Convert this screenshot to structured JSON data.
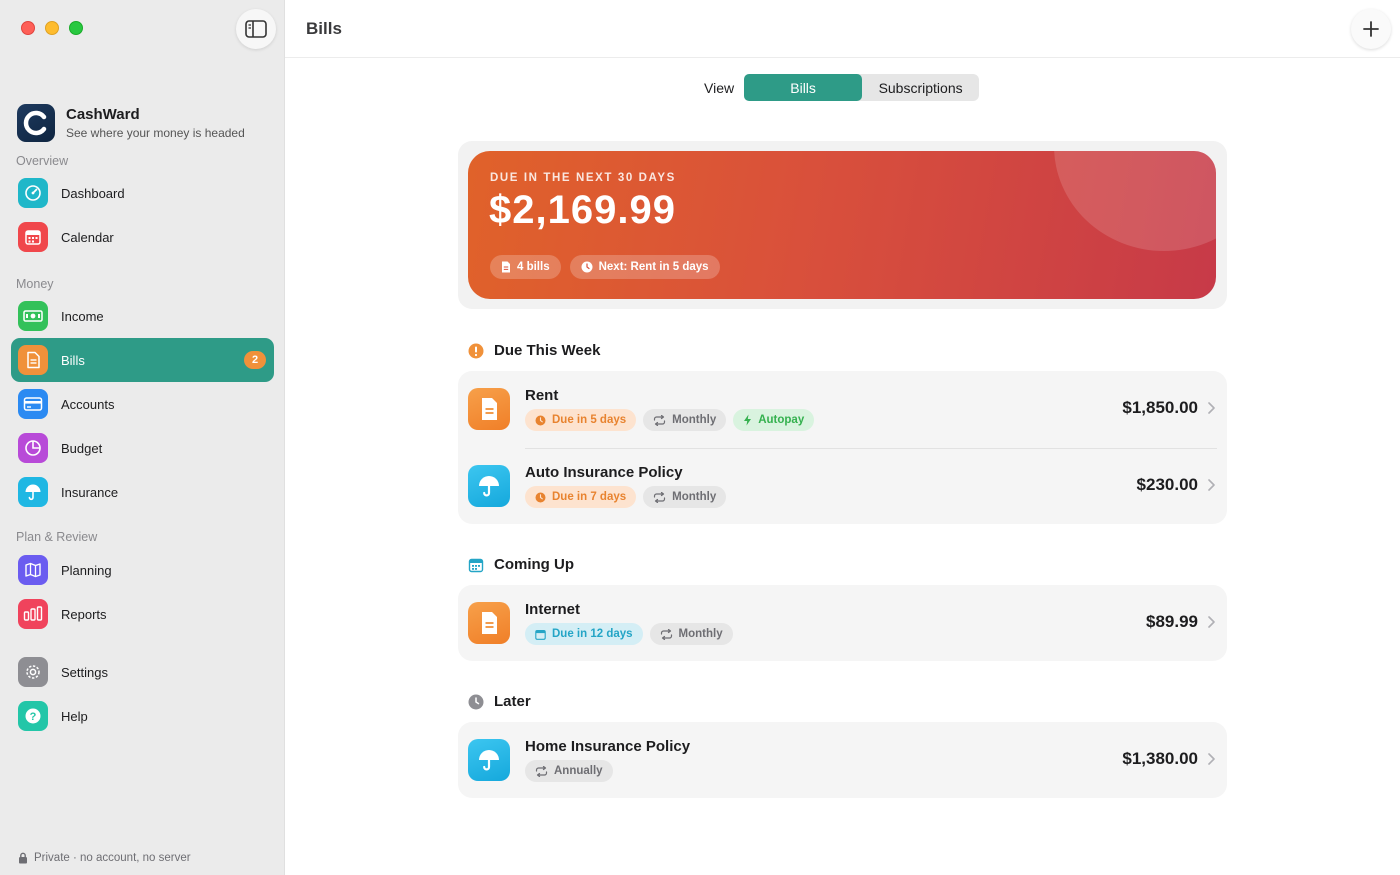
{
  "app": {
    "name": "CashWard",
    "tagline": "See where your money is headed",
    "footer_note": "Private · no account, no server"
  },
  "sidebar": {
    "sections": [
      {
        "label": "Overview"
      },
      {
        "label": "Money"
      },
      {
        "label": "Plan & Review"
      }
    ],
    "items": [
      {
        "label": "Dashboard",
        "icon": "gauge-icon",
        "color": "#1fb7c9"
      },
      {
        "label": "Calendar",
        "icon": "calendar-icon",
        "color": "#f0474b"
      },
      {
        "label": "Income",
        "icon": "banknote-icon",
        "color": "#33c15a"
      },
      {
        "label": "Bills",
        "icon": "document-icon",
        "color": "#f0913a",
        "badge": "2",
        "active": true
      },
      {
        "label": "Accounts",
        "icon": "card-icon",
        "color": "#2b8af2"
      },
      {
        "label": "Budget",
        "icon": "pie-icon",
        "color": "#b84ad8"
      },
      {
        "label": "Insurance",
        "icon": "umbrella-icon",
        "color": "#1fb7e3"
      },
      {
        "label": "Planning",
        "icon": "map-icon",
        "color": "#6b5cf0"
      },
      {
        "label": "Reports",
        "icon": "bar-chart-icon",
        "color": "#f0435c"
      },
      {
        "label": "Settings",
        "icon": "gear-icon",
        "color": "#8e8e93"
      },
      {
        "label": "Help",
        "icon": "question-icon",
        "color": "#23c6a8"
      }
    ]
  },
  "header": {
    "title": "Bills"
  },
  "view_switch": {
    "label": "View",
    "options": [
      "Bills",
      "Subscriptions"
    ],
    "selected": "Bills"
  },
  "summary": {
    "label": "DUE IN THE NEXT 30 DAYS",
    "amount": "$2,169.99",
    "bills_chip": "4 bills",
    "next_chip": "Next: Rent in 5 days"
  },
  "groups": [
    {
      "title": "Due This Week",
      "icon": "exclamation-icon",
      "bills": [
        {
          "name": "Rent",
          "icon": "document-icon",
          "amount": "$1,850.00",
          "chips": [
            {
              "text": "Due in 5 days",
              "style": "orange",
              "icon": "clock-icon"
            },
            {
              "text": "Monthly",
              "style": "gray",
              "icon": "repeat-icon"
            },
            {
              "text": "Autopay",
              "style": "green",
              "icon": "bolt-icon"
            }
          ]
        },
        {
          "name": "Auto Insurance Policy",
          "icon": "umbrella-icon",
          "amount": "$230.00",
          "chips": [
            {
              "text": "Due in 7 days",
              "style": "orange",
              "icon": "clock-icon"
            },
            {
              "text": "Monthly",
              "style": "gray",
              "icon": "repeat-icon"
            }
          ]
        }
      ]
    },
    {
      "title": "Coming Up",
      "icon": "calendar-icon",
      "bills": [
        {
          "name": "Internet",
          "icon": "document-icon",
          "amount": "$89.99",
          "chips": [
            {
              "text": "Due in 12 days",
              "style": "teal",
              "icon": "calendar-icon"
            },
            {
              "text": "Monthly",
              "style": "gray",
              "icon": "repeat-icon"
            }
          ]
        }
      ]
    },
    {
      "title": "Later",
      "icon": "clock-icon",
      "bills": [
        {
          "name": "Home Insurance Policy",
          "icon": "umbrella-icon",
          "amount": "$1,380.00",
          "chips": [
            {
              "text": "Annually",
              "style": "gray",
              "icon": "repeat-icon"
            }
          ]
        }
      ]
    }
  ]
}
